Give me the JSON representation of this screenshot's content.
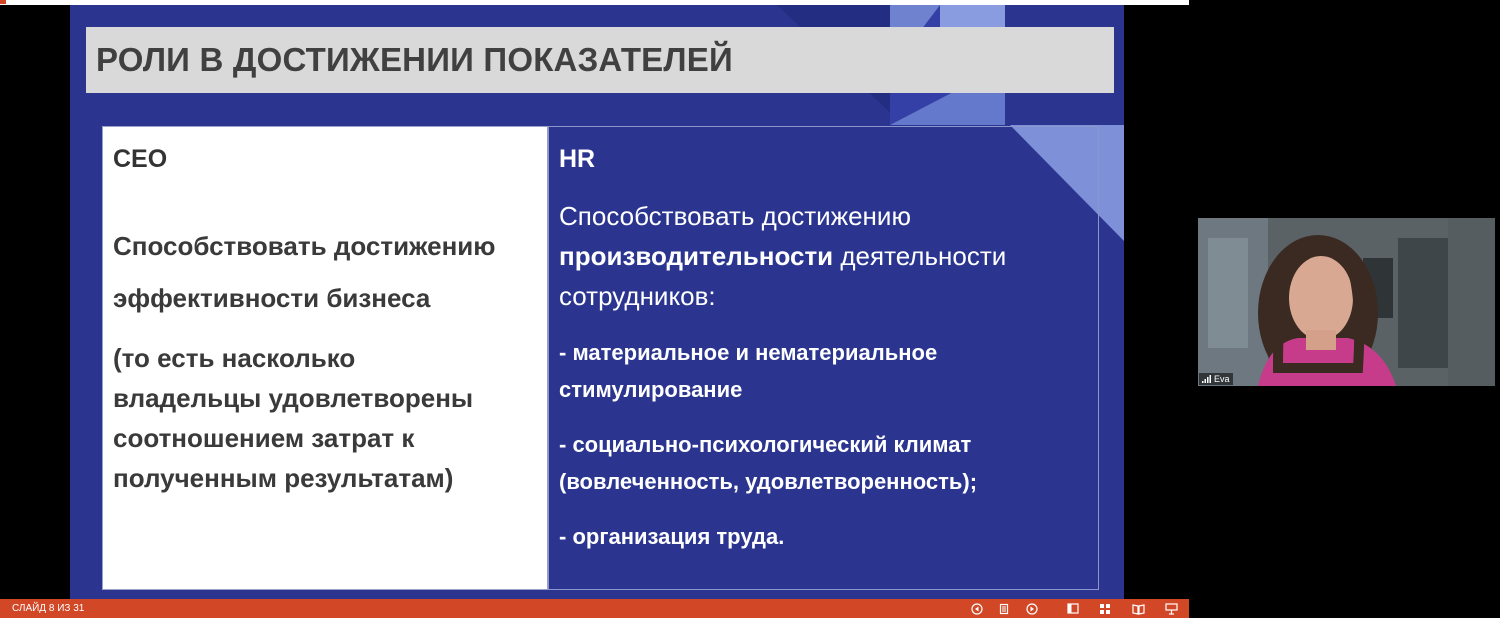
{
  "slide": {
    "title": "РОЛИ В ДОСТИЖЕНИИ ПОКАЗАТЕЛЕЙ",
    "ceo": {
      "heading": "CEO",
      "main_line1": "Способствовать достижению",
      "main_line2": "эффективности бизнеса",
      "note_line1": "(то есть насколько",
      "note_line2": "владельцы удовлетворены",
      "note_line3": "соотношением затрат к",
      "note_line4": "полученным результатам)"
    },
    "hr": {
      "heading": "HR",
      "intro_line1": "Способствовать достижению",
      "intro_bold": "производительности",
      "intro_rest": " деятельности",
      "intro_line3": "сотрудников:",
      "bullet1_line1": "- материальное и нематериальное",
      "bullet1_line2": "стимулирование",
      "bullet2_line1": "- социально-психологический климат",
      "bullet2_line2": "(вовлеченность, удовлетворенность);",
      "bullet3": "-  организация труда."
    }
  },
  "statusbar": {
    "slide_counter": "СЛАЙД 8 ИЗ 31",
    "icons": [
      "previous-slide-icon",
      "notes-icon",
      "next-slide-icon",
      "normal-view-icon",
      "slide-sorter-icon",
      "reading-view-icon",
      "slideshow-icon"
    ]
  },
  "participant": {
    "name": "Eva",
    "icon": "signal-bars-icon"
  },
  "colors": {
    "slide_background": "#2b3590",
    "accent_light": "#7b8fd6",
    "title_bar": "#d9d9d9",
    "statusbar": "#d24726"
  }
}
